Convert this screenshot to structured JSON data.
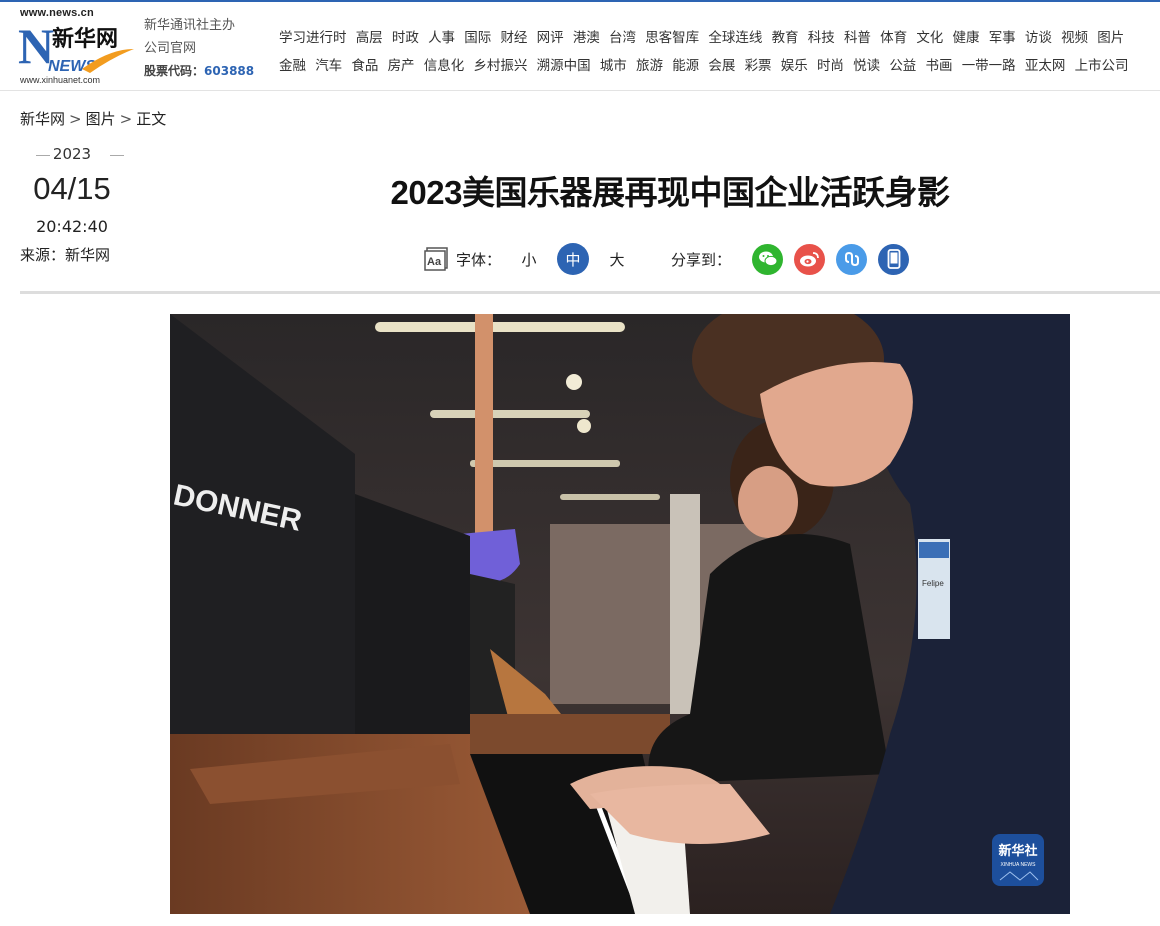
{
  "header": {
    "logo_url_top": "www.news.cn",
    "logo_text": "新华网",
    "logo_news": "NEWS",
    "logo_url_bottom": "www.xinhuanet.com",
    "org_line1": "新华通讯社主办",
    "org_line2": "公司官网",
    "stock_label": "股票代码：",
    "stock_code": "603888"
  },
  "nav": {
    "row1": [
      "学习进行时",
      "高层",
      "时政",
      "人事",
      "国际",
      "财经",
      "网评",
      "港澳",
      "台湾",
      "思客智库",
      "全球连线",
      "教育",
      "科技",
      "科普",
      "体育",
      "文化",
      "健康",
      "军事",
      "访谈",
      "视频",
      "图片"
    ],
    "row2": [
      "金融",
      "汽车",
      "食品",
      "房产",
      "信息化",
      "乡村振兴",
      "溯源中国",
      "城市",
      "旅游",
      "能源",
      "会展",
      "彩票",
      "娱乐",
      "时尚",
      "悦读",
      "公益",
      "书画",
      "一带一路",
      "亚太网",
      "上市公司"
    ]
  },
  "breadcrumb": {
    "home": "新华网",
    "sep": ">",
    "section": "图片",
    "current": "正文"
  },
  "article": {
    "year": "2023",
    "date": "04/15",
    "time": "20:42:40",
    "source": "来源：新华网",
    "title": "2023美国乐器展再现中国企业活跃身影"
  },
  "tools": {
    "font_label": "字体：",
    "sizes": [
      "小",
      "中",
      "大"
    ],
    "share_label": "分享到："
  },
  "photo": {
    "brand_text": "DONNER",
    "watermark_cn": "新华社",
    "watermark_en": "XINHUA NEWS",
    "badge_text": "Felipe"
  },
  "colors": {
    "accent": "#2d64b3",
    "wechat": "#2fb52f",
    "weibo": "#e8524a",
    "link": "#4a9be8",
    "mobile": "#2d64b3"
  }
}
